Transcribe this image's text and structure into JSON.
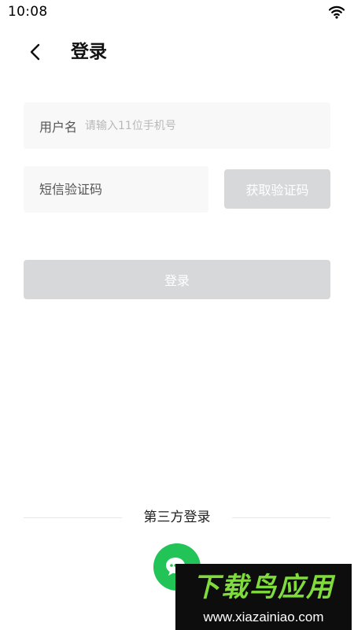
{
  "status_bar": {
    "time": "10:08",
    "icon": "wifi-icon"
  },
  "nav": {
    "back_icon": "chevron-left-icon",
    "title": "登录"
  },
  "form": {
    "username_label": "用户名",
    "username_placeholder": "请输入11位手机号",
    "sms_placeholder": "短信验证码",
    "get_code_label": "获取验证码",
    "login_label": "登录"
  },
  "third_party": {
    "label": "第三方登录",
    "wechat_icon": "wechat-icon"
  },
  "watermark": {
    "title": "下载鸟应用",
    "url": "www.xiazainiao.com"
  },
  "colors": {
    "disabled_button": "#d7d8da",
    "input_bg": "#f8f8f8",
    "wechat_green": "#22c357",
    "watermark_green": "#7fdc3c"
  }
}
